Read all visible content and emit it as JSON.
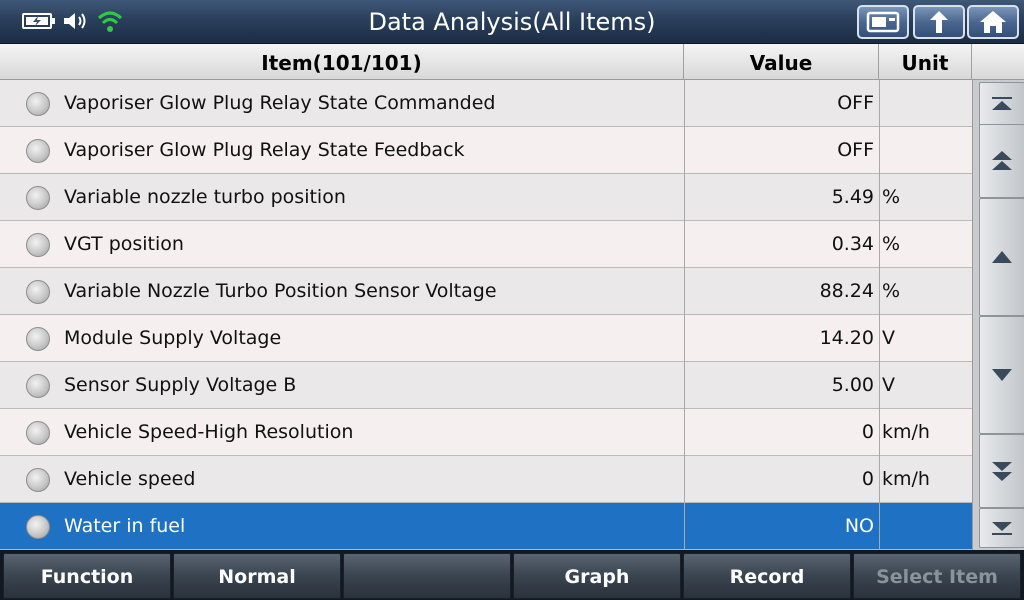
{
  "header": {
    "title": "Data Analysis(All Items)",
    "status_icons": [
      "battery-charging-icon",
      "speaker-icon",
      "wifi-icon"
    ],
    "buttons": [
      "screenshot-icon",
      "back-icon",
      "home-icon"
    ]
  },
  "table": {
    "columns": {
      "item": "Item(101/101)",
      "value": "Value",
      "unit": "Unit"
    },
    "rows": [
      {
        "name": "Vaporiser Glow Plug Relay State Commanded",
        "value": "OFF",
        "unit": ""
      },
      {
        "name": "Vaporiser Glow Plug Relay State Feedback",
        "value": "OFF",
        "unit": ""
      },
      {
        "name": "Variable nozzle turbo position",
        "value": "5.49",
        "unit": "%"
      },
      {
        "name": "VGT position",
        "value": "0.34",
        "unit": "%"
      },
      {
        "name": "Variable Nozzle Turbo Position Sensor Voltage",
        "value": "88.24",
        "unit": "%"
      },
      {
        "name": "Module Supply Voltage",
        "value": "14.20",
        "unit": "V"
      },
      {
        "name": "Sensor Supply Voltage B",
        "value": "5.00",
        "unit": "V"
      },
      {
        "name": "Vehicle Speed-High Resolution",
        "value": "0",
        "unit": "km/h"
      },
      {
        "name": "Vehicle speed",
        "value": "0",
        "unit": "km/h"
      },
      {
        "name": "Water in fuel",
        "value": "NO",
        "unit": ""
      }
    ],
    "selected_row": 9
  },
  "scroll": [
    "scroll-top-icon",
    "page-up-icon",
    "line-up-icon",
    "line-down-icon",
    "page-down-icon",
    "scroll-bottom-icon"
  ],
  "toolbar": {
    "buttons": [
      {
        "label": "Function",
        "enabled": true
      },
      {
        "label": "Normal",
        "enabled": true
      },
      {
        "label": "",
        "enabled": true
      },
      {
        "label": "Graph",
        "enabled": true
      },
      {
        "label": "Record",
        "enabled": true
      },
      {
        "label": "Select Item",
        "enabled": false
      }
    ]
  },
  "colors": {
    "selected_row": "#1f72c3",
    "wifi": "#2ecc40",
    "title_bar": "#2a3f5c"
  }
}
